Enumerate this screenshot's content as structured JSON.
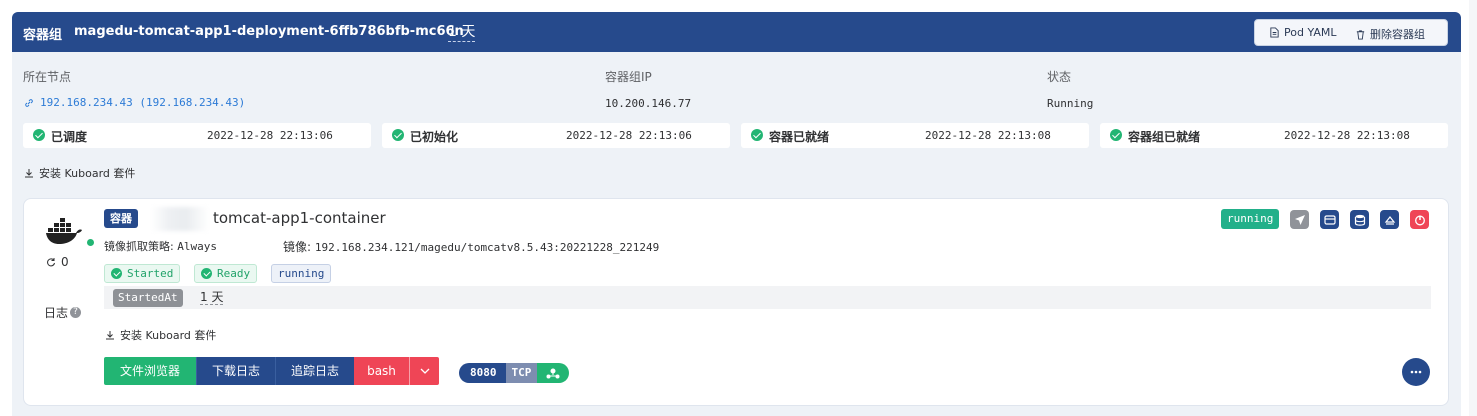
{
  "header": {
    "kind": "容器组",
    "pod_name": "magedu-tomcat-app1-deployment-6ffb786bfb-mc66n",
    "age": "1 天",
    "pod_yaml_label": "Pod YAML",
    "delete_label": "删除容器组"
  },
  "info": {
    "node_label": "所在节点",
    "node_value": "192.168.234.43 (192.168.234.43)",
    "pod_ip_label": "容器组IP",
    "pod_ip_value": "10.200.146.77",
    "status_label": "状态",
    "status_value": "Running"
  },
  "conditions": [
    {
      "name": "已调度",
      "time": "2022-12-28 22:13:06"
    },
    {
      "name": "已初始化",
      "time": "2022-12-28 22:13:06"
    },
    {
      "name": "容器已就绪",
      "time": "2022-12-28 22:13:08"
    },
    {
      "name": "容器组已就绪",
      "time": "2022-12-28 22:13:08"
    }
  ],
  "install_kuboard_label": "安装 Kuboard 套件",
  "container": {
    "kind_tag": "容器",
    "name": "tomcat-app1-container",
    "restart_count": "0",
    "logs_label": "日志",
    "pull_policy_label": "镜像抓取策略:",
    "pull_policy_value": "Always",
    "image_label": "镜像:",
    "image_value": "192.168.234.121/magedu/tomcatv8.5.43:20221228_221249",
    "tags": {
      "started": "Started",
      "ready": "Ready",
      "state": "running"
    },
    "state_key": "StartedAt",
    "state_value": "1 天",
    "install_kuboard_label": "安装 Kuboard 套件",
    "status_badge": "running",
    "buttons": {
      "file_browser": "文件浏览器",
      "download_logs": "下载日志",
      "tail_logs": "追踪日志",
      "bash": "bash"
    },
    "port": {
      "number": "8080",
      "protocol": "TCP"
    }
  },
  "colors": {
    "primary": "#264a8c",
    "success": "#22b573",
    "danger": "#ef4556",
    "panel_bg": "#eef2f7"
  },
  "icons": [
    "pod-yaml-icon",
    "trash-icon",
    "link-icon",
    "check-circle-icon",
    "download-icon",
    "docker-icon",
    "refresh-icon",
    "question-icon",
    "send-icon",
    "terminal-icon",
    "database-icon",
    "eject-icon",
    "power-icon",
    "chevron-down-icon",
    "network-icon",
    "more-icon"
  ]
}
